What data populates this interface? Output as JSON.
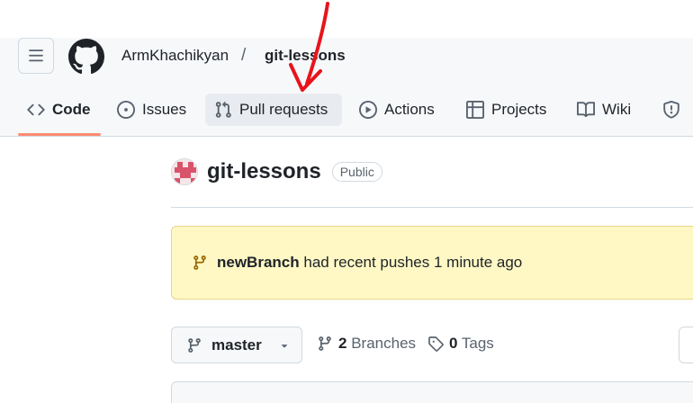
{
  "header": {
    "owner": "ArmKhachikyan",
    "separator": "/",
    "repo": "git-lessons"
  },
  "nav": {
    "tabs": [
      {
        "label": "Code",
        "icon": "code-icon",
        "selected": true
      },
      {
        "label": "Issues",
        "icon": "issue-opened-icon"
      },
      {
        "label": "Pull requests",
        "icon": "git-pull-request-icon",
        "hovered": true
      },
      {
        "label": "Actions",
        "icon": "play-icon"
      },
      {
        "label": "Projects",
        "icon": "table-icon"
      },
      {
        "label": "Wiki",
        "icon": "book-icon"
      },
      {
        "label": "",
        "icon": "shield-icon"
      }
    ]
  },
  "repo": {
    "name": "git-lessons",
    "visibility": "Public"
  },
  "flash": {
    "branch": "newBranch",
    "message": "had recent pushes 1 minute ago"
  },
  "toolbar": {
    "branch": "master",
    "branches_count": "2",
    "branches_label": "Branches",
    "tags_count": "0",
    "tags_label": "Tags"
  },
  "colors": {
    "annotation_arrow": "#e8141b",
    "selected_tab_underline": "#fd8c73",
    "flash_background": "#fff8c5",
    "header_background": "#f6f8fa"
  }
}
